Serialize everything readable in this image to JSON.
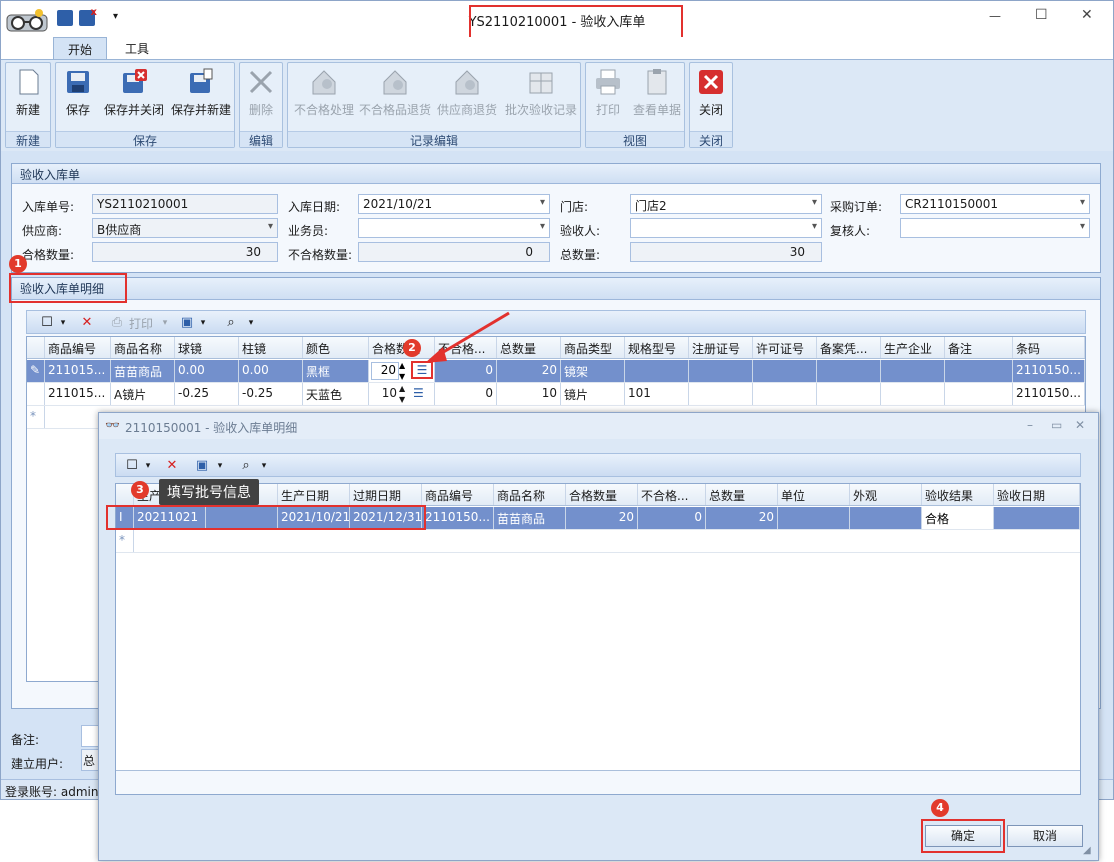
{
  "window": {
    "title": "YS2110210001 - 验收入库单",
    "minimize": "—",
    "maximize": "☐",
    "close": "✕"
  },
  "tabs": [
    "开始",
    "工具"
  ],
  "ribbon": {
    "groups": [
      "新建",
      "保存",
      "编辑",
      "记录编辑",
      "视图",
      "关闭"
    ],
    "buttons": {
      "new": "新建",
      "save": "保存",
      "save_close": "保存并关闭",
      "save_new": "保存并新建",
      "delete": "删除",
      "nonconform": "不合格处理",
      "nonconform_return": "不合格品退货",
      "supplier_return": "供应商退货",
      "batch_record": "批次验收记录",
      "print": "打印",
      "view_doc": "查看单据",
      "close": "关闭"
    }
  },
  "header_panel": {
    "title": "验收入库单",
    "fields": {
      "doc_no_label": "入库单号:",
      "doc_no": "YS2110210001",
      "date_label": "入库日期:",
      "date": "2021/10/21",
      "store_label": "门店:",
      "store": "门店2",
      "po_label": "采购订单:",
      "po": "CR2110150001",
      "supplier_label": "供应商:",
      "supplier": "B供应商",
      "salesman_label": "业务员:",
      "salesman": "",
      "inspector_label": "验收人:",
      "inspector": "",
      "reviewer_label": "复核人:",
      "reviewer": "",
      "qualified_label": "合格数量:",
      "qualified": "30",
      "unqualified_label": "不合格数量:",
      "unqualified": "0",
      "total_label": "总数量:",
      "total": "30"
    }
  },
  "detail_panel": {
    "title": "验收入库单明细",
    "print_label": "打印",
    "columns": [
      "商品编号",
      "商品名称",
      "球镜",
      "柱镜",
      "颜色",
      "合格数量",
      "不合格...",
      "总数量",
      "商品类型",
      "规格型号",
      "注册证号",
      "许可证号",
      "备案凭...",
      "生产企业",
      "备注",
      "条码"
    ],
    "rows": [
      {
        "code": "211015...",
        "name": "苗苗商品",
        "sph": "0.00",
        "cyl": "0.00",
        "color": "黑框",
        "ok": "20",
        "bad": "0",
        "total": "20",
        "type": "镜架",
        "spec": "",
        "barcode": "2110150..."
      },
      {
        "code": "211015...",
        "name": "A镜片",
        "sph": "-0.25",
        "cyl": "-0.25",
        "color": "天蓝色",
        "ok": "10",
        "bad": "0",
        "total": "10",
        "type": "镜片",
        "spec": "101",
        "barcode": "2110150..."
      }
    ]
  },
  "bottom": {
    "remark_label": "备注:",
    "creator_label": "建立用户:",
    "creator_value": "总",
    "status_account": "登录账号: admin"
  },
  "dialog": {
    "title": "2110150001 - 验收入库单明细",
    "columns": [
      "生产批号",
      "生产批次",
      "生产日期",
      "过期日期",
      "商品编号",
      "商品名称",
      "合格数量",
      "不合格...",
      "总数量",
      "单位",
      "外观",
      "验收结果",
      "验收日期"
    ],
    "row": {
      "batch": "20211021",
      "lot": "",
      "mfg": "2021/10/21",
      "exp": "2021/12/31",
      "code": "2110150...",
      "name": "苗苗商品",
      "ok": "20",
      "bad": "0",
      "total": "20",
      "unit": "",
      "look": "",
      "result": "合格",
      "date": ""
    },
    "tooltip": "填写批号信息",
    "ok_button": "确定",
    "cancel_button": "取消"
  },
  "markers": [
    "1",
    "2",
    "3",
    "4"
  ],
  "colors": {
    "highlight": "#e2312e",
    "selected_row": "#7390cc",
    "accent": "#dce8f6"
  }
}
